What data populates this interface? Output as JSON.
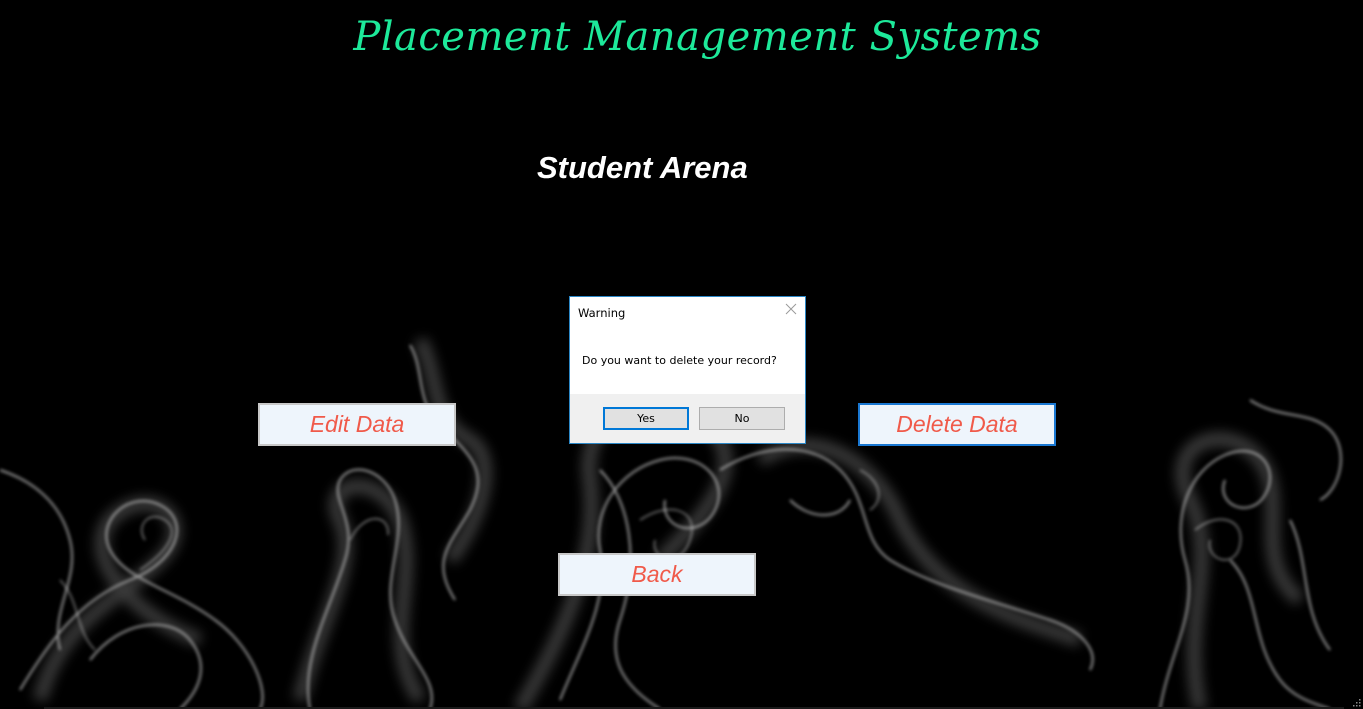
{
  "app": {
    "title": "Placement Management Systems",
    "subtitle": "Student Arena",
    "title_color": "#1de99a",
    "button_text_color": "#f05a4a",
    "button_bg_color": "#eef5fc"
  },
  "buttons": {
    "edit_label": "Edit Data",
    "delete_label": "Delete Data",
    "back_label": "Back"
  },
  "dialog": {
    "title": "Warning",
    "message": "Do you want to delete your record?",
    "yes_label": "Yes",
    "no_label": "No",
    "close_icon": "close-icon",
    "accent_color": "#0078d7"
  },
  "background": {
    "description_icon": "smoke-background"
  }
}
